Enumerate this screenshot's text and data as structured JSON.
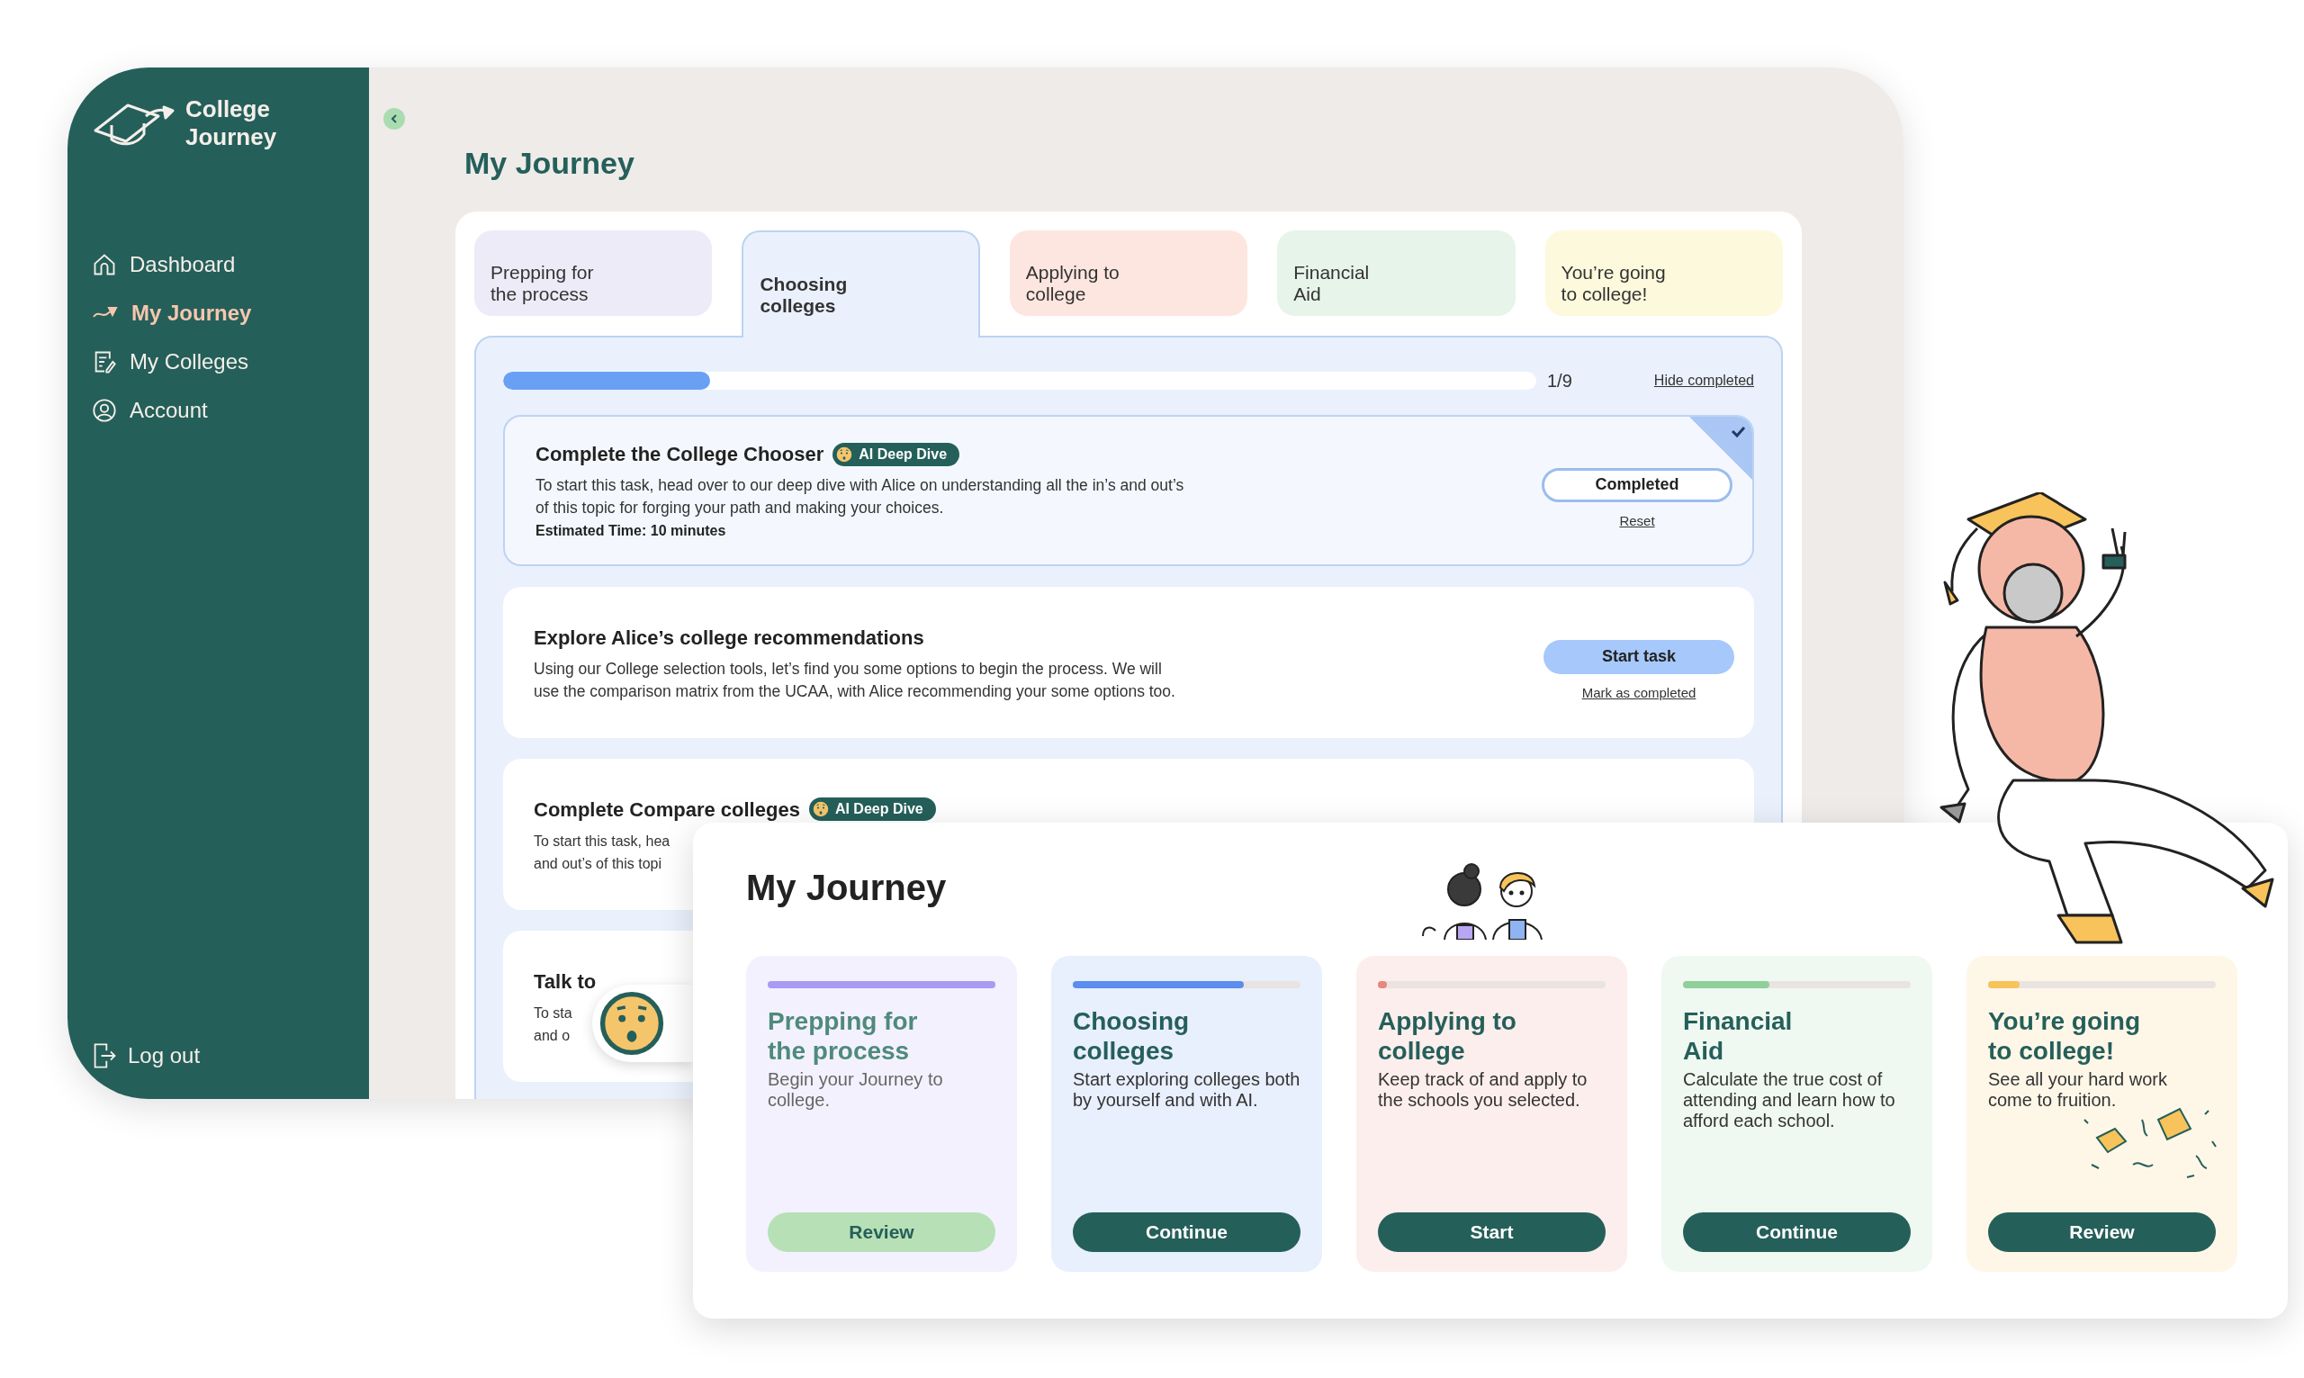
{
  "sidebar": {
    "brand": "College\nJourney",
    "items": [
      {
        "label": "Dashboard",
        "selected": false
      },
      {
        "label": "My Journey",
        "selected": true
      },
      {
        "label": "My Colleges",
        "selected": false
      },
      {
        "label": "Account",
        "selected": false
      }
    ],
    "logout": "Log out"
  },
  "page_title": "My Journey",
  "tabs": [
    {
      "label": "Prepping for\nthe process",
      "color": "#ecebf7",
      "selected": false
    },
    {
      "label": "Choosing\ncolleges",
      "color": "#eaf1fc",
      "selected": true
    },
    {
      "label": "Applying to\ncollege",
      "color": "#fde6df",
      "selected": false
    },
    {
      "label": "Financial\nAid",
      "color": "#e7f4ea",
      "selected": false
    },
    {
      "label": "You’re going\nto college!",
      "color": "#fdf9dc",
      "selected": false
    }
  ],
  "progress": {
    "level": 0.2,
    "count": "1/9",
    "link": "Hide completed"
  },
  "tasks": [
    {
      "title": "Complete the College Chooser",
      "badge": "AI Deep Dive",
      "description": "To start this task, head over to our deep dive with Alice on understanding all the in’s and out’s of this topic for forging your path and making your choices.",
      "estimate": "Estimated Time: 10 minutes",
      "completed": true,
      "button": "Completed",
      "link": "Reset"
    },
    {
      "title": "Explore Alice’s college recommendations",
      "description": "Using our College selection tools, let’s find you some options to begin the process. We will use the comparison matrix from the UCAA, with Alice recommending your some options too.",
      "completed": false,
      "button": "Start task",
      "link": "Mark as completed"
    },
    {
      "title": "Complete Compare colleges",
      "badge": "AI Deep Dive",
      "lines": [
        "To start this task, hea",
        "and out’s of this topi"
      ],
      "completed": false
    },
    {
      "title": "Talk to",
      "lines": [
        "To sta",
        "and o"
      ],
      "completed": false
    }
  ],
  "overview": {
    "title": "My Journey",
    "stages": [
      {
        "title": "Prepping for\nthe process",
        "description": "Begin your Journey to college.",
        "color": "#a99af4",
        "level": 1,
        "completed": true,
        "button": "Review"
      },
      {
        "title": "Choosing\ncolleges",
        "description": "Start exploring colleges both by yourself and with AI.",
        "color": "#5b8def",
        "level": 0.75,
        "completed": false,
        "button": "Continue"
      },
      {
        "title": "Applying to\ncollege",
        "description": "Keep track of and apply to the schools you selected.",
        "color": "#e8877a",
        "level": 0.04,
        "completed": false,
        "button": "Start"
      },
      {
        "title": "Financial\nAid",
        "description": "Calculate the true cost of attending and learn how to afford each school.",
        "color": "#8fcf9a",
        "level": 0.38,
        "completed": false,
        "button": "Continue"
      },
      {
        "title": "You’re going\nto college!",
        "description": "See all your hard work come to fruition.",
        "color": "#f7c35a",
        "level": 0.14,
        "completed": false,
        "button": "Review"
      }
    ]
  }
}
